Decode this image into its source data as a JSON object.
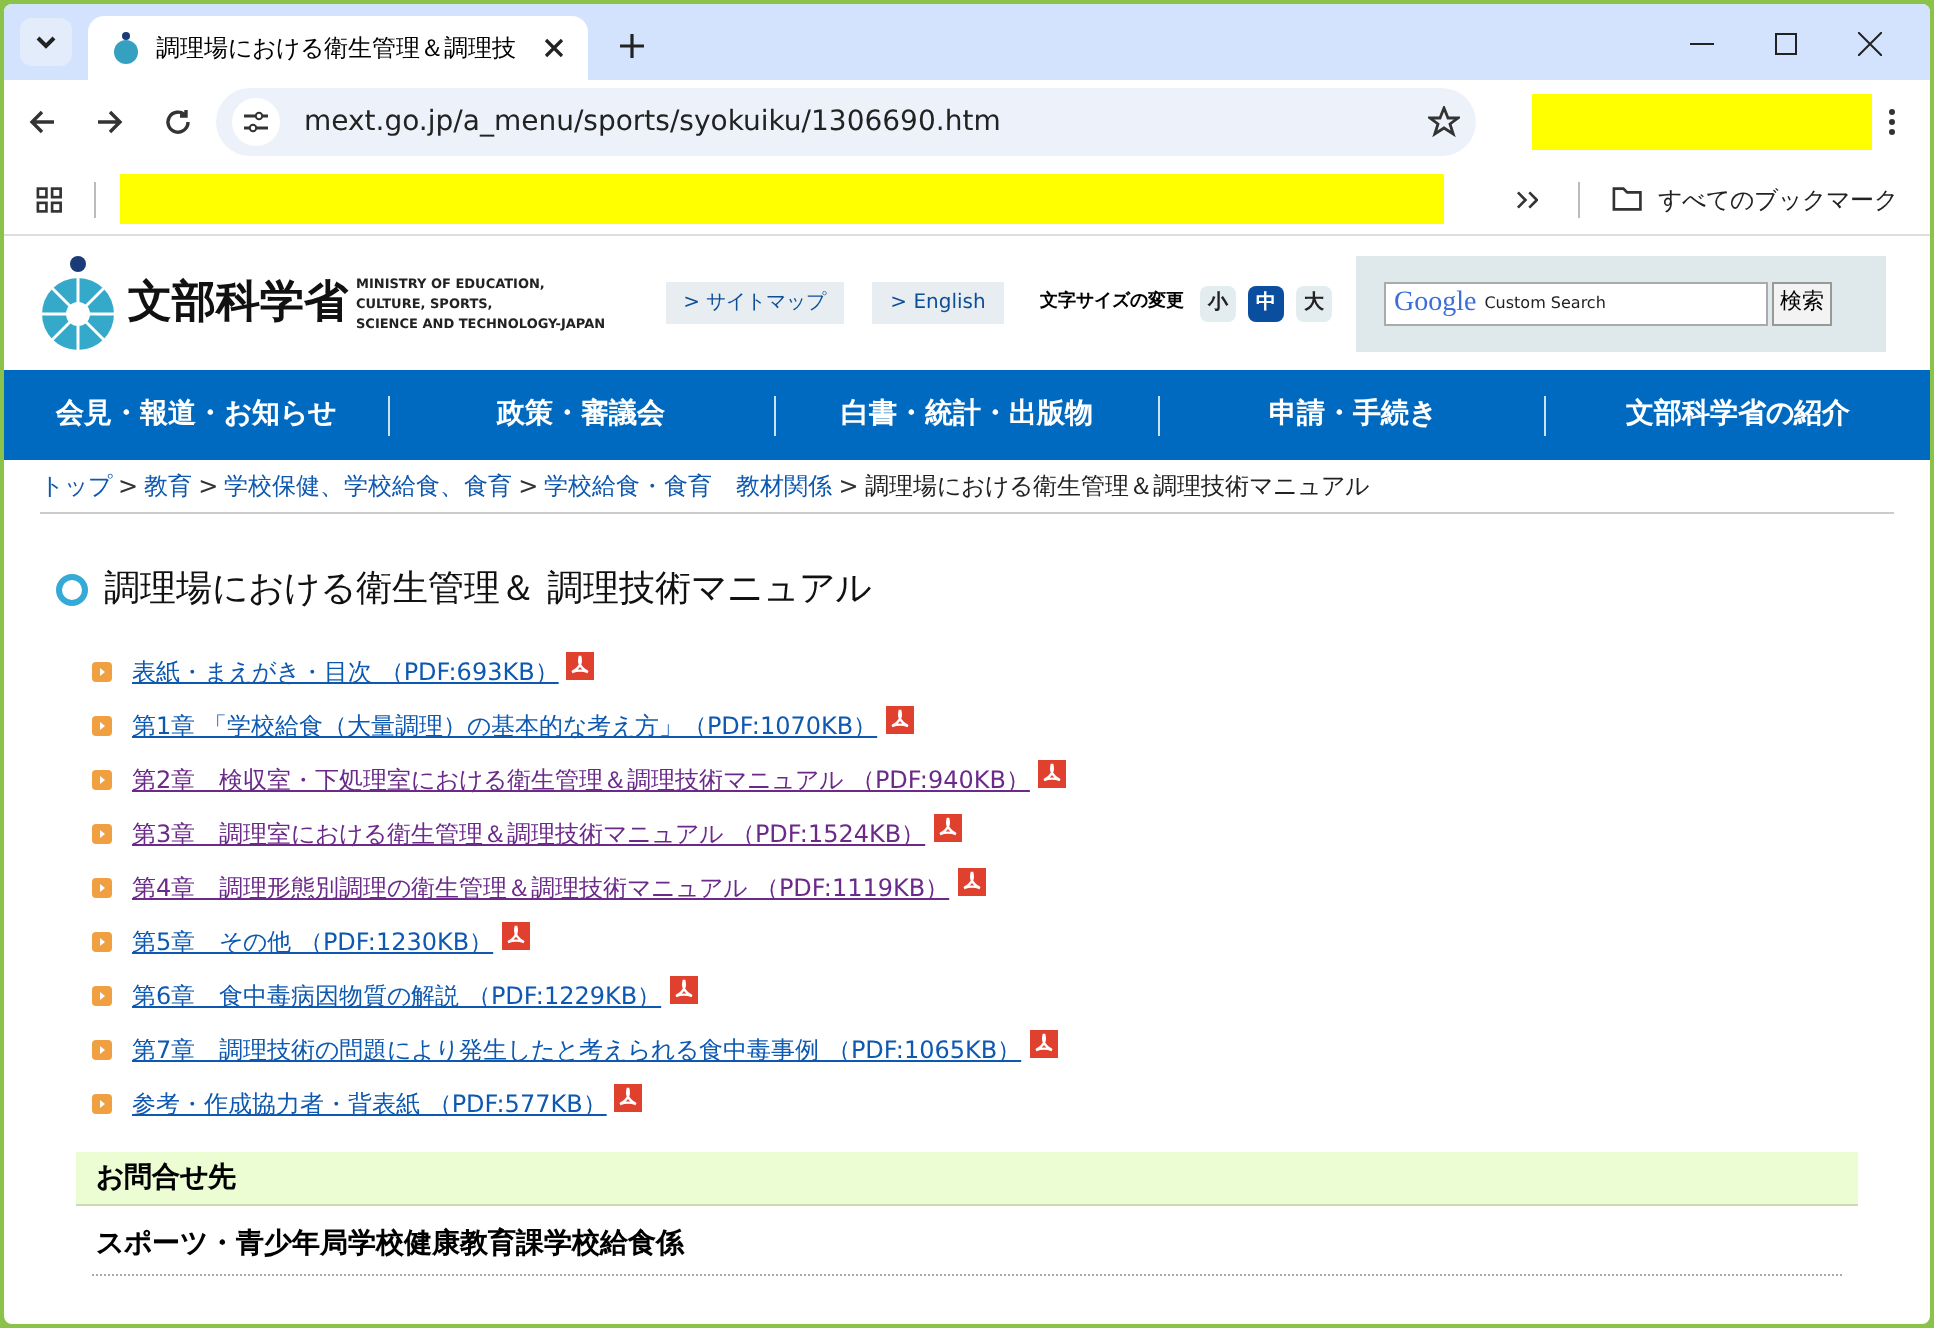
{
  "browser": {
    "tab_title": "調理場における衛生管理＆調理技",
    "url": "mext.go.jp/a_menu/sports/syokuiku/1306690.htm",
    "bookmarks_label": "すべてのブックマーク"
  },
  "header": {
    "logo_text": "文部科学省",
    "logo_subtitle": [
      "MINISTRY OF EDUCATION,",
      "CULTURE, SPORTS,",
      "SCIENCE AND TECHNOLOGY-JAPAN"
    ],
    "links": [
      "> サイトマップ",
      "> English"
    ],
    "font_size_label": "文字サイズの変更",
    "font_sizes": [
      {
        "label": "小",
        "selected": false
      },
      {
        "label": "中",
        "selected": true
      },
      {
        "label": "大",
        "selected": false
      }
    ],
    "search": {
      "brand": "Google",
      "brand_suffix": "Custom Search",
      "button": "検索"
    }
  },
  "nav": [
    "会見・報道・お知らせ",
    "政策・審議会",
    "白書・統計・出版物",
    "申請・手続き",
    "文部科学省の紹介"
  ],
  "breadcrumb_separator": ">",
  "breadcrumb": [
    {
      "label": "トップ",
      "link": true
    },
    {
      "label": "教育",
      "link": true
    },
    {
      "label": "学校保健、学校給食、食育",
      "link": true
    },
    {
      "label": "学校給食・食育　教材関係",
      "link": true
    },
    {
      "label": "調理場における衛生管理＆調理技術マニュアル",
      "link": false
    }
  ],
  "title": "調理場における衛生管理＆ 調理技術マニュアル",
  "documents": [
    {
      "label": "表紙・まえがき・目次 （PDF:693KB）",
      "visited": false
    },
    {
      "label": "第1章 「学校給食（大量調理）の基本的な考え方」（PDF:1070KB）",
      "visited": false
    },
    {
      "label": "第2章　検収室・下処理室における衛生管理＆調理技術マニュアル （PDF:940KB）",
      "visited": true
    },
    {
      "label": "第3章　調理室における衛生管理＆調理技術マニュアル （PDF:1524KB）",
      "visited": true
    },
    {
      "label": "第4章　調理形態別調理の衛生管理＆調理技術マニュアル （PDF:1119KB）",
      "visited": true
    },
    {
      "label": "第5章　その他 （PDF:1230KB）",
      "visited": false
    },
    {
      "label": "第6章　食中毒病因物質の解説 （PDF:1229KB）",
      "visited": false
    },
    {
      "label": "第7章　調理技術の問題により発生したと考えられる食中毒事例 （PDF:1065KB）",
      "visited": false
    },
    {
      "label": "参考・作成協力者・背表紙 （PDF:577KB）",
      "visited": false
    }
  ],
  "contact": {
    "heading": "お問合せ先",
    "department": "スポーツ・青少年局学校健康教育課学校給食係"
  }
}
